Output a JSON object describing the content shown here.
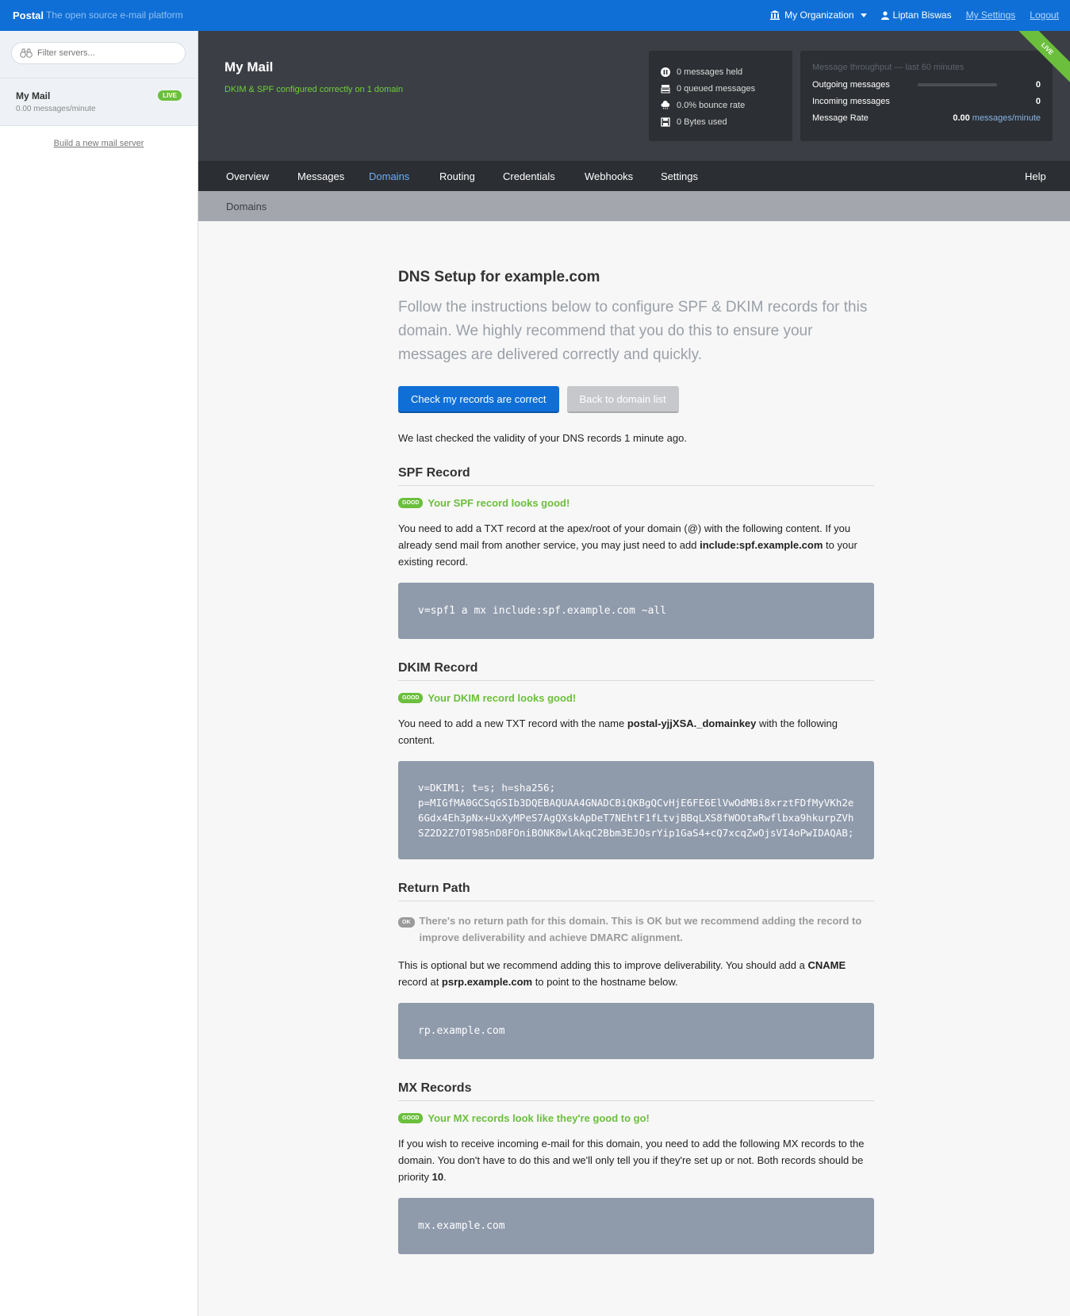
{
  "topbar": {
    "brand": "Postal",
    "tagline": "The open source e-mail platform",
    "org": "My Organization",
    "user": "Liptan Biswas",
    "settings": "My Settings",
    "logout": "Logout"
  },
  "sidebar": {
    "filter_placeholder": "Filter servers...",
    "server_name": "My Mail",
    "server_rate": "0.00 messages/minute",
    "server_badge": "LIVE",
    "build_link": "Build a new mail server"
  },
  "header": {
    "title": "My Mail",
    "subtitle": "DKIM & SPF configured correctly on 1 domain",
    "stats": {
      "held": "0 messages held",
      "queued": "0 queued messages",
      "bounce": "0.0% bounce rate",
      "bytes": "0 Bytes used"
    },
    "throughput": {
      "title": "Message throughput — last 60 minutes",
      "outgoing_label": "Outgoing messages",
      "outgoing_value": "0",
      "incoming_label": "Incoming messages",
      "incoming_value": "0",
      "rate_label": "Message Rate",
      "rate_value": "0.00",
      "rate_unit": "messages/minute"
    },
    "ribbon": "LIVE"
  },
  "nav": {
    "overview": "Overview",
    "messages": "Messages",
    "domains": "Domains",
    "routing": "Routing",
    "credentials": "Credentials",
    "webhooks": "Webhooks",
    "settings": "Settings",
    "help": "Help"
  },
  "subnav": {
    "title": "Domains"
  },
  "main": {
    "title": "DNS Setup for example.com",
    "intro": "Follow the instructions below to configure SPF & DKIM records for this domain. We highly recommend that you do this to ensure your messages are delivered correctly and quickly.",
    "check_button": "Check my records are correct",
    "back_button": "Back to domain list",
    "last_checked": "We last checked the validity of your DNS records 1 minute ago.",
    "spf": {
      "heading": "SPF Record",
      "badge": "GOOD",
      "status": "Your SPF record looks good!",
      "text1": "You need to add a TXT record at the apex/root of your domain (@) with the following content. If you already send mail from another service, you may just need to add ",
      "bold1": "include:spf.example.com",
      "text2": " to your existing record.",
      "code": "v=spf1 a mx include:spf.example.com ~all"
    },
    "dkim": {
      "heading": "DKIM Record",
      "badge": "GOOD",
      "status": "Your DKIM record looks good!",
      "text1": "You need to add a new TXT record with the name ",
      "bold1": "postal-yjjXSA._domainkey",
      "text2": " with the following content.",
      "code_line1": "v=DKIM1; t=s; h=sha256;",
      "code_line2": "p=MIGfMA0GCSqGSIb3DQEBAQUAA4GNADCBiQKBgQCvHjE6FE6ElVwOdMBi8xrztFDfMyVKh2e6Gdx4Eh3pNx+UxXyMPeS7AgQXskApDeT7NEhtF1fLtvjBBqLXS8fWOOtaRwflbxa9hkurpZVhSZ2D2Z7OT985nD8FOniBONK8wlAkqC2Bbm3EJOsrYip1GaS4+cQ7xcqZwOjsVI4oPwIDAQAB;"
    },
    "return_path": {
      "heading": "Return Path",
      "badge": "OK",
      "status": "There's no return path for this domain. This is OK but we recommend adding the record to improve deliverability and achieve DMARC alignment.",
      "text1": "This is optional but we recommend adding this to improve deliverability. You should add a ",
      "bold1": "CNAME",
      "text2": " record at ",
      "bold2": "psrp.example.com",
      "text3": " to point to the hostname below.",
      "code": "rp.example.com"
    },
    "mx": {
      "heading": "MX Records",
      "badge": "GOOD",
      "status": "Your MX records look like they're good to go!",
      "text1": "If you wish to receive incoming e-mail for this domain, you need to add the following MX records to the domain. You don't have to do this and we'll only tell you if they're set up or not. Both records should be priority ",
      "bold1": "10",
      "text2": ".",
      "code": "mx.example.com"
    }
  }
}
